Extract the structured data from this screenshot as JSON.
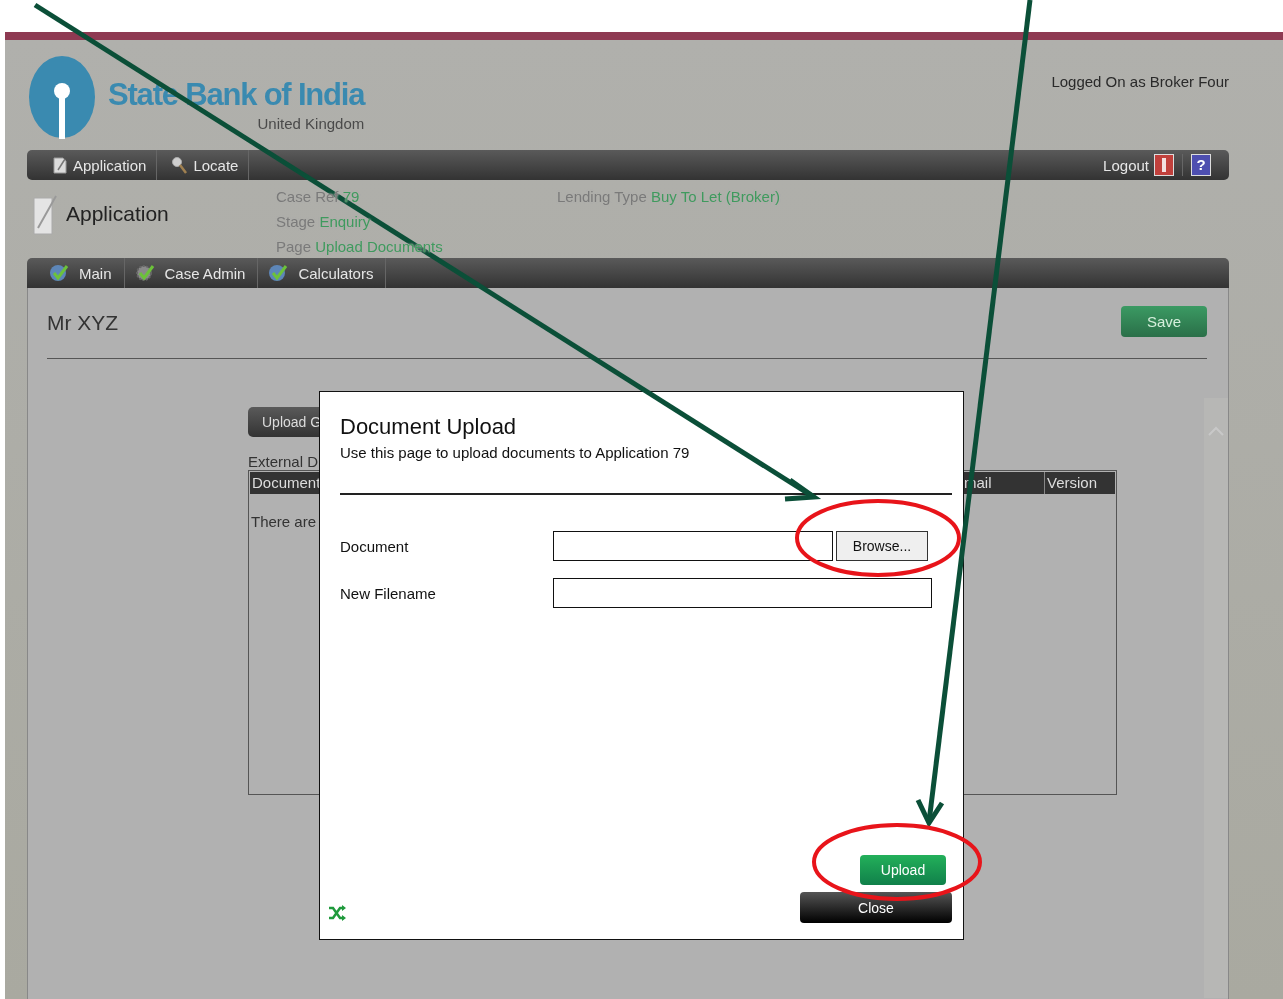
{
  "header": {
    "brand": "State Bank of India",
    "region": "United Kingdom",
    "user": "Logged On as Broker Four"
  },
  "main_nav": {
    "items": [
      {
        "label": "Application"
      },
      {
        "label": "Locate"
      }
    ],
    "logout": "Logout",
    "help": "?"
  },
  "page_header": {
    "title": "Application",
    "details": [
      {
        "label": "Case Ref",
        "value": "79"
      },
      {
        "label": "Stage",
        "value": "Enquiry"
      },
      {
        "label": "Page",
        "value": "Upload Documents"
      }
    ],
    "lending": {
      "label": "Lending Type",
      "value": "Buy To Let (Broker)"
    }
  },
  "tabs": [
    {
      "label": "Main"
    },
    {
      "label": "Case Admin"
    },
    {
      "label": "Calculators"
    }
  ],
  "record": {
    "name": "Mr XYZ",
    "save": "Save",
    "upload_button": "Upload G",
    "table_caption": "External D",
    "columns": [
      "Document",
      "mail",
      "Version"
    ],
    "empty_message": "There are"
  },
  "dialog": {
    "title": "Document Upload",
    "subtitle": "Use this page to upload documents to Application 79",
    "fields": [
      {
        "label": "Document",
        "kind": "file",
        "button": "Browse..."
      },
      {
        "label": "New Filename",
        "kind": "text"
      }
    ],
    "buttons": [
      {
        "label": "Upload",
        "kind": "primary"
      },
      {
        "label": "Close",
        "kind": "secondary"
      }
    ]
  }
}
